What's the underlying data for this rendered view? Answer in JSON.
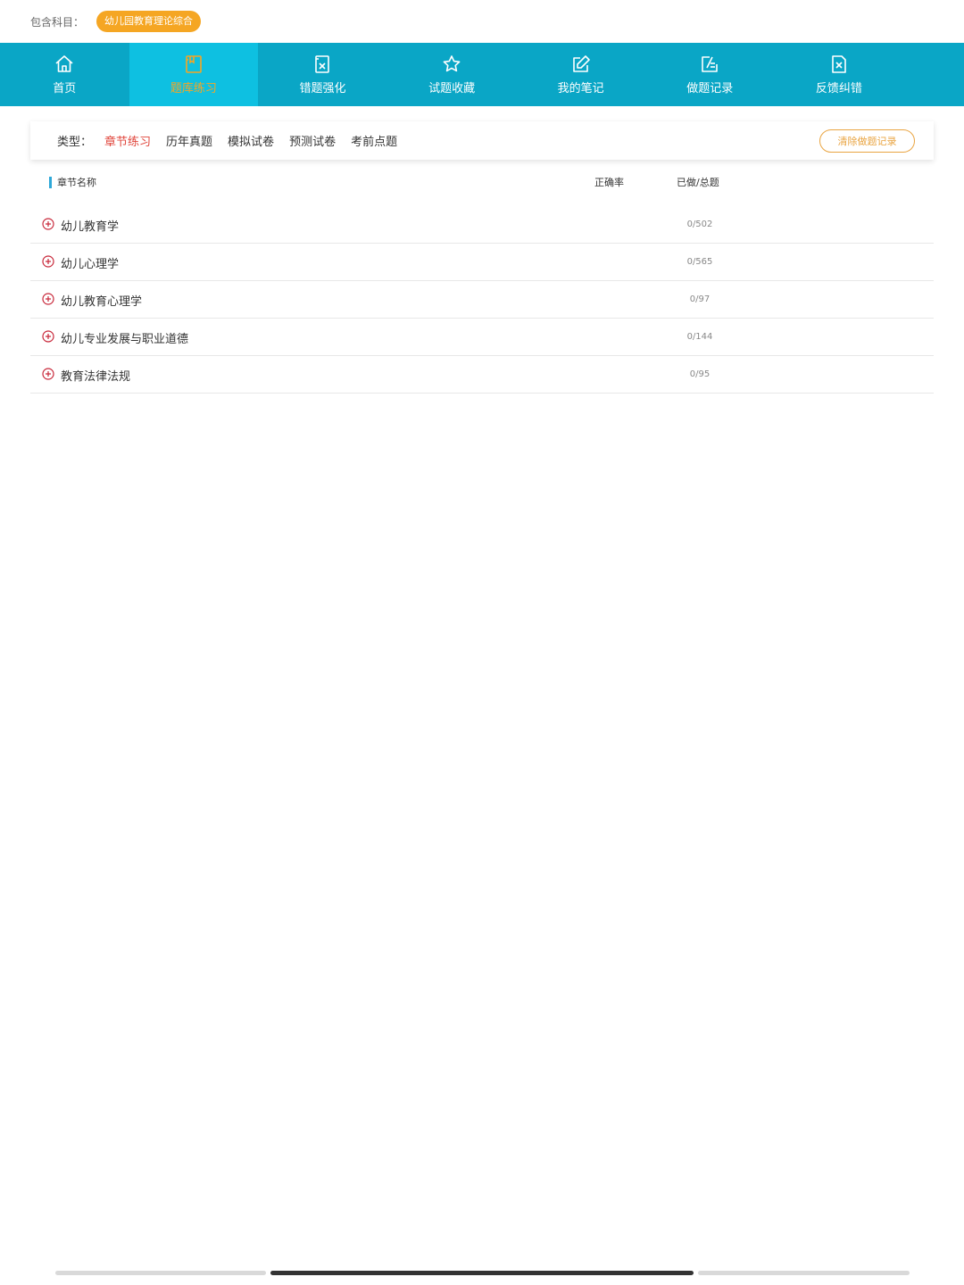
{
  "subject": {
    "label": "包含科目：",
    "chip": "幼儿园教育理论综合"
  },
  "nav": {
    "items": [
      {
        "label": "首页",
        "icon": "home-icon",
        "active": false
      },
      {
        "label": "题库练习",
        "icon": "book-icon",
        "active": true
      },
      {
        "label": "错题强化",
        "icon": "wrong-doc-icon",
        "active": false
      },
      {
        "label": "试题收藏",
        "icon": "star-icon",
        "active": false
      },
      {
        "label": "我的笔记",
        "icon": "edit-icon",
        "active": false
      },
      {
        "label": "做题记录",
        "icon": "record-icon",
        "active": false
      },
      {
        "label": "反馈纠错",
        "icon": "feedback-x-icon",
        "active": false
      }
    ]
  },
  "filter": {
    "label": "类型：",
    "tabs": [
      {
        "label": "章节练习",
        "active": true
      },
      {
        "label": "历年真题",
        "active": false
      },
      {
        "label": "模拟试卷",
        "active": false
      },
      {
        "label": "预测试卷",
        "active": false
      },
      {
        "label": "考前点题",
        "active": false
      }
    ],
    "clear_button": "清除做题记录"
  },
  "table": {
    "headers": {
      "name": "章节名称",
      "accuracy": "正确率",
      "done_total": "已做/总题"
    },
    "rows": [
      {
        "name": "幼儿教育学",
        "count": "0/502"
      },
      {
        "name": "幼儿心理学",
        "count": "0/565"
      },
      {
        "name": "幼儿教育心理学",
        "count": "0/97"
      },
      {
        "name": "幼儿专业发展与职业道德",
        "count": "0/144"
      },
      {
        "name": "教育法律法规",
        "count": "0/95"
      }
    ]
  },
  "colors": {
    "nav_bg": "#0aa6c6",
    "nav_active_bg": "#0ec0e1",
    "accent_orange": "#f5a623",
    "active_tab_red": "#e0463c",
    "plus_icon_red": "#c8283a"
  }
}
